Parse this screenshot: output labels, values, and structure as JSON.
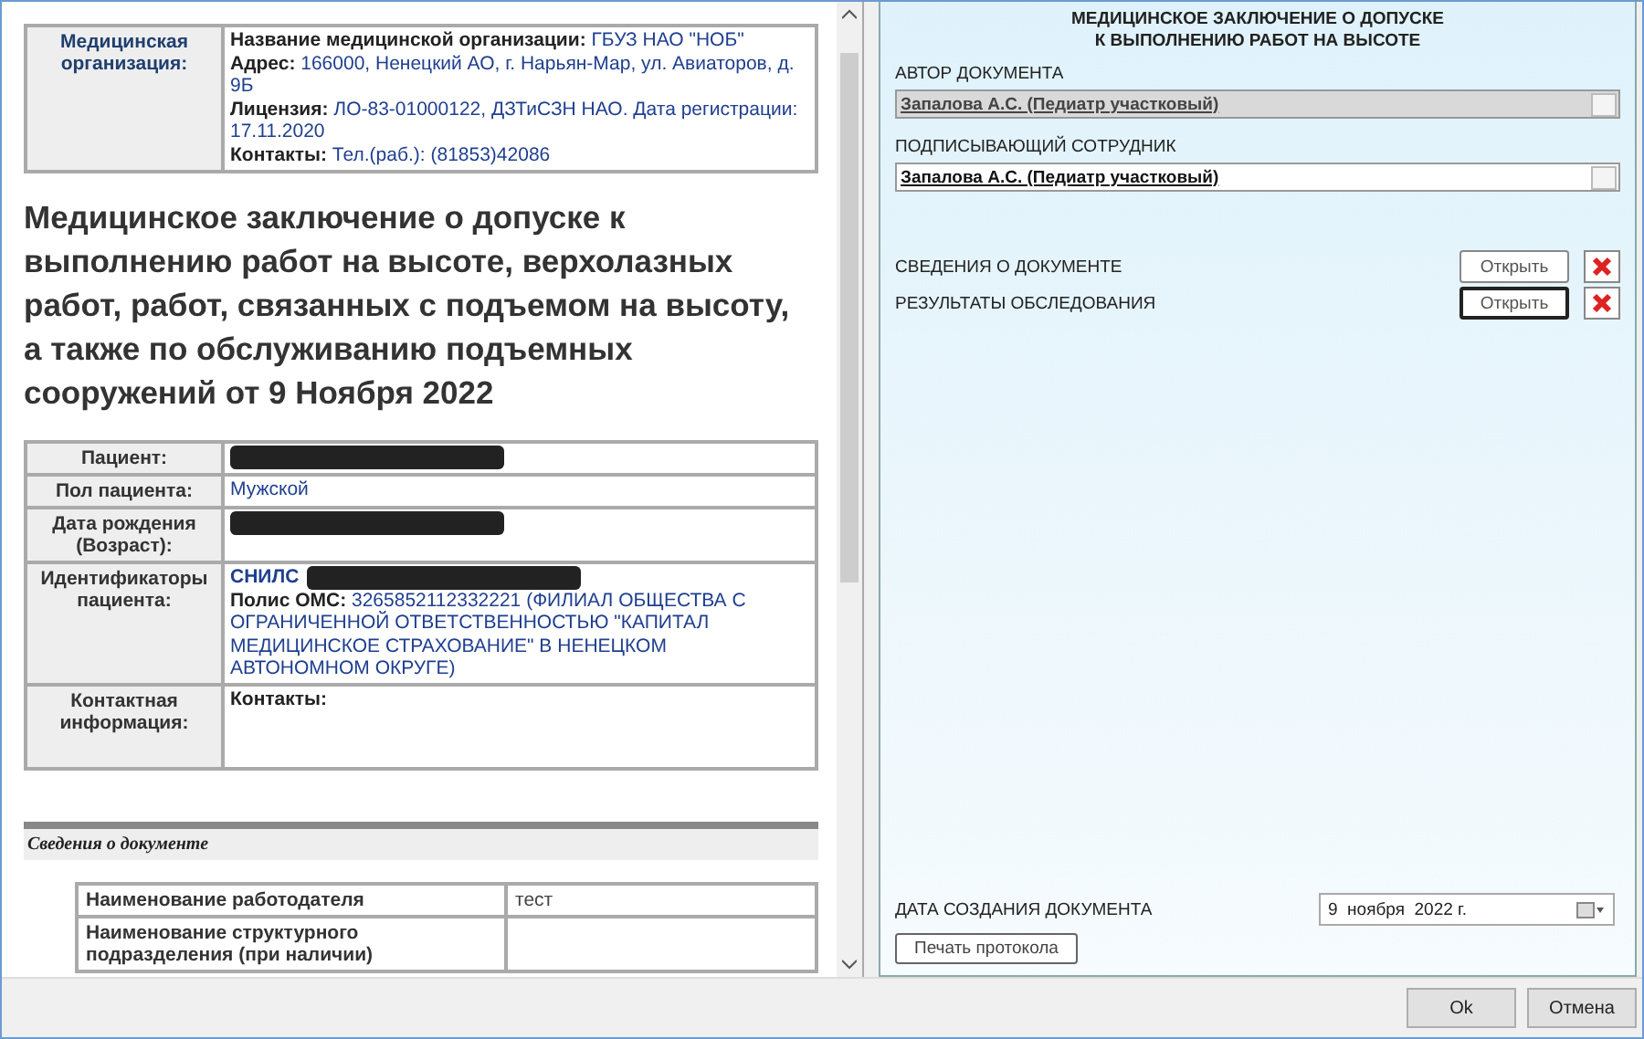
{
  "organization": {
    "label": "Медицинская организация:",
    "lines": [
      "**Название медицинской организации:** ГБУЗ НАО \"НОБ\"",
      "**Адрес:** 166000, Ненецкий АО, г. Нарьян-Мар, ул. Авиаторов, д. 9Б",
      "**Лицензия:** ЛО-83-01000122, ДЗТиСЗН НАО. Дата регистрации: 17.11.2020",
      "**Контакты:** Тел.(раб.): (81853)42086"
    ]
  },
  "document_title": "Медицинское заключение о допуске к выполнению работ на высоте, верхолазных работ, работ, связанных с подъемом на высоту, а также по обслуживанию подъемных сооружений от 9 Ноября 2022",
  "patient_rows": [
    {
      "label": "Пациент:",
      "lines": [
        {
          "kind": "redacted"
        }
      ]
    },
    {
      "label": "Пол пациента:",
      "lines": [
        {
          "kind": "text",
          "text": "Мужской"
        }
      ]
    },
    {
      "label": "Дата рождения (Возраст):",
      "lines": [
        {
          "kind": "redacted"
        }
      ]
    },
    {
      "label": "Идентификаторы пациента:",
      "lines": [
        {
          "kind": "redacted",
          "text": "**СНИЛС**"
        },
        {
          "kind": "text",
          "text": "**Полис ОМС:** 3265852112332221 (ФИЛИАЛ ОБЩЕСТВА С ОГРАНИЧЕННОЙ ОТВЕТСТВЕННОСТЬЮ \"КАПИТАЛ МЕДИЦИНСКОЕ СТРАХОВАНИЕ\" В НЕНЕЦКОМ АВТОНОМНОМ ОКРУГЕ)"
        }
      ]
    },
    {
      "label": "Контактная информация:",
      "lines": [
        {
          "kind": "text",
          "text": "**Контакты:**"
        }
      ]
    }
  ],
  "section_heading": "Сведения о документе",
  "document_rows": [
    {
      "label": "Наименование работодателя",
      "value": "тест"
    },
    {
      "label": "Наименование структурного подразделения (при наличии)"
    }
  ],
  "form": {
    "title_lines": [
      "МЕДИЦИНСКОЕ ЗАКЛЮЧЕНИЕ О ДОПУСКЕ",
      "К ВЫПОЛНЕНИЮ РАБОТ НА ВЫСОТЕ"
    ],
    "fields": [
      {
        "label": "АВТОР ДОКУМЕНТА",
        "value": "Запалова А.С. (Педиатр участковый)",
        "disabled": true
      },
      {
        "label": "ПОДПИСЫВАЮЩИЙ СОТРУДНИК",
        "value": "Запалова А.С. (Педиатр участковый)",
        "disabled": false
      }
    ],
    "attachments": [
      {
        "label": "СВЕДЕНИЯ О ДОКУМЕНТЕ",
        "button": "Открыть",
        "focused": false
      },
      {
        "label": "РЕЗУЛЬТАТЫ ОБСЛЕДОВАНИЯ",
        "button": "Открыть",
        "focused": true
      }
    ],
    "date_label": "ДАТА СОЗДАНИЯ ДОКУМЕНТА",
    "date_value": "9  ноября  2022 г.",
    "print_button": "Печать протокола"
  },
  "buttons": [
    "Ok",
    "Отмена"
  ]
}
